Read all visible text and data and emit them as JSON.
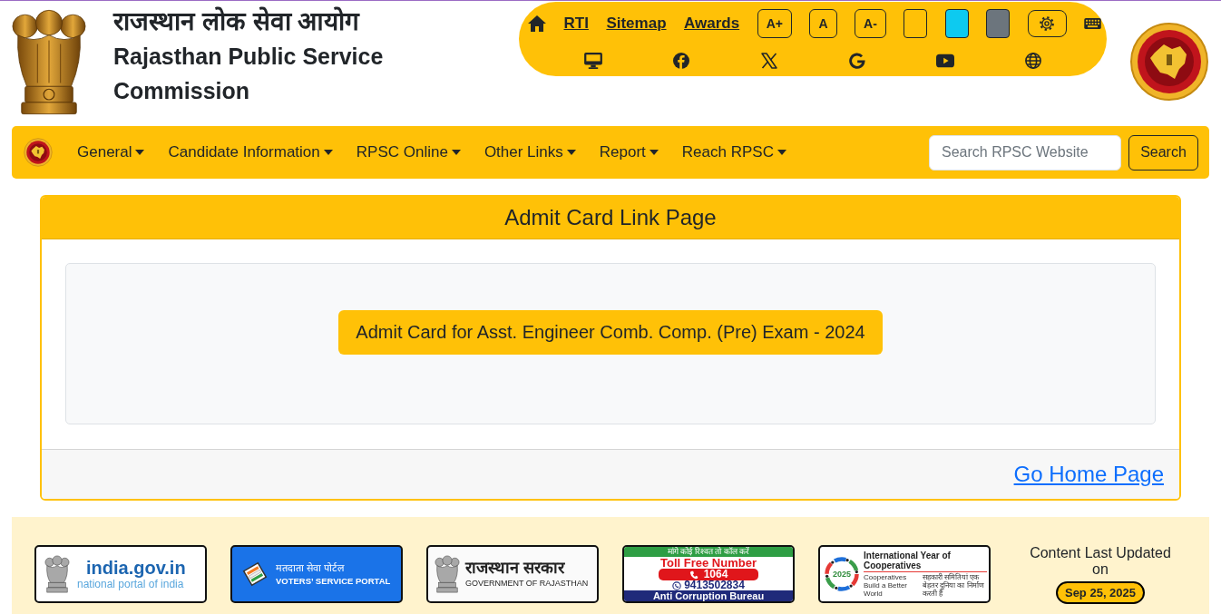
{
  "header": {
    "title_hindi": "राजस्थान लोक सेवा आयोग",
    "title_english": "Rajasthan Public Service Commission"
  },
  "toolbar": {
    "links": [
      {
        "label": "RTI"
      },
      {
        "label": "Sitemap"
      },
      {
        "label": "Awards"
      }
    ],
    "font_size_buttons": [
      {
        "label": "A+"
      },
      {
        "label": "A"
      },
      {
        "label": "A-"
      }
    ],
    "theme_swatches": [
      {
        "color": "#ffc107"
      },
      {
        "color": "#0dcaf0"
      },
      {
        "color": "#6c757d"
      }
    ]
  },
  "nav": {
    "items": [
      {
        "label": "General"
      },
      {
        "label": "Candidate Information"
      },
      {
        "label": "RPSC Online"
      },
      {
        "label": "Other Links"
      },
      {
        "label": "Report"
      },
      {
        "label": "Reach RPSC"
      }
    ],
    "search": {
      "placeholder": "Search RPSC Website",
      "button": "Search"
    }
  },
  "card": {
    "title": "Admit Card Link Page",
    "links": [
      {
        "label": "Admit Card for Asst. Engineer Comb. Comp. (Pre) Exam - 2024"
      }
    ],
    "footer_link": "Go Home Page"
  },
  "footer": {
    "banners": [
      {
        "kind": "india_portal",
        "title": "india.gov.in",
        "subtitle": "national portal of india"
      },
      {
        "kind": "voters_portal",
        "title": "मतदाता सेवा पोर्टल",
        "subtitle": "VOTERS’ SERVICE PORTAL"
      },
      {
        "kind": "rajasthan_govt",
        "title": "राजस्थान सरकार",
        "subtitle": "GOVERNMENT OF RAJASTHAN"
      },
      {
        "kind": "anti_corruption",
        "tagline": "मांगे कोई रिश्वत तो कॉल करें",
        "title": "Toll Free Number",
        "helpline": "1064",
        "whatsapp": "9413502834",
        "footer": "Anti Corruption Bureau"
      },
      {
        "kind": "cooperatives",
        "year": "2025",
        "title": "International Year of Cooperatives",
        "tagline": "Cooperatives Build a Better World",
        "tagline_hindi": "सहकारी समितियां एक बेहतर दुनिया का निर्माण करती हैं"
      }
    ],
    "last_updated": {
      "label": "Content Last Updated on",
      "date": "Sep 25, 2025"
    }
  }
}
